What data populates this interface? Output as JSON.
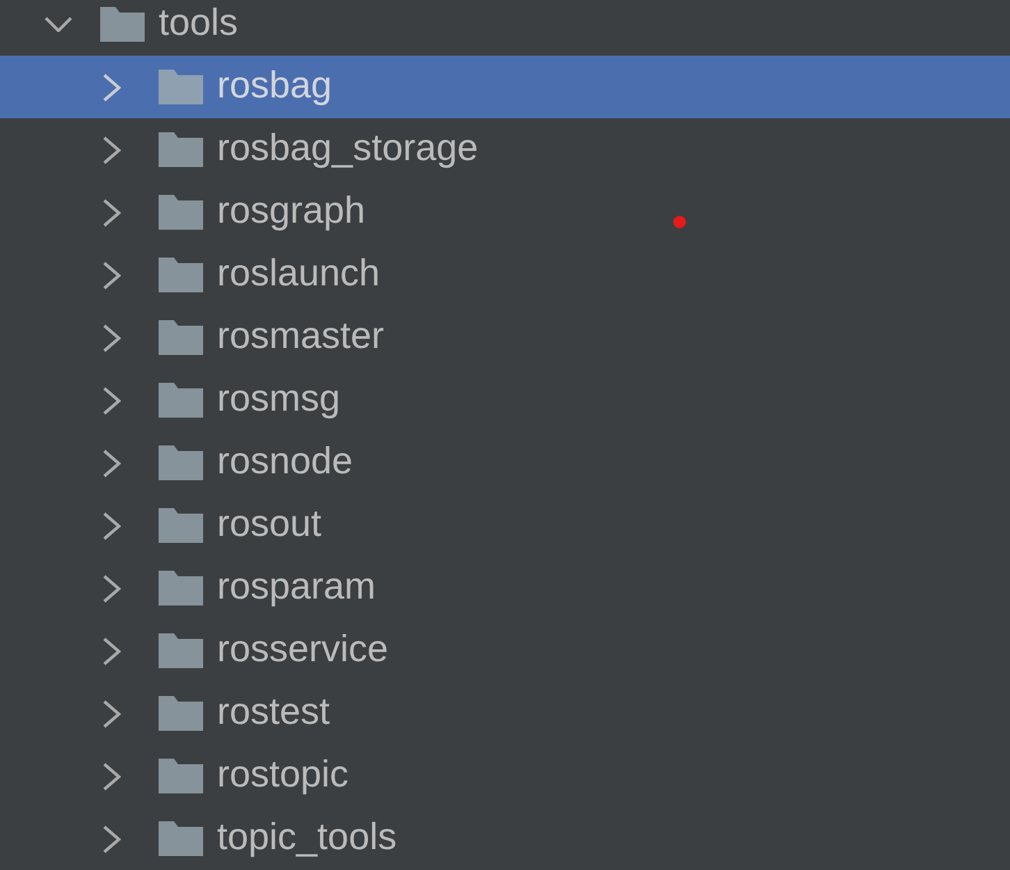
{
  "tree": [
    {
      "label": "tools",
      "expanded": true,
      "selected": false,
      "children": [
        {
          "label": "rosbag",
          "expanded": false,
          "selected": true
        },
        {
          "label": "rosbag_storage",
          "expanded": false,
          "selected": false
        },
        {
          "label": "rosgraph",
          "expanded": false,
          "selected": false
        },
        {
          "label": "roslaunch",
          "expanded": false,
          "selected": false
        },
        {
          "label": "rosmaster",
          "expanded": false,
          "selected": false
        },
        {
          "label": "rosmsg",
          "expanded": false,
          "selected": false
        },
        {
          "label": "rosnode",
          "expanded": false,
          "selected": false
        },
        {
          "label": "rosout",
          "expanded": false,
          "selected": false
        },
        {
          "label": "rosparam",
          "expanded": false,
          "selected": false
        },
        {
          "label": "rosservice",
          "expanded": false,
          "selected": false
        },
        {
          "label": "rostest",
          "expanded": false,
          "selected": false
        },
        {
          "label": "rostopic",
          "expanded": false,
          "selected": false
        },
        {
          "label": "topic_tools",
          "expanded": false,
          "selected": false
        }
      ]
    }
  ],
  "marker_dot": true
}
